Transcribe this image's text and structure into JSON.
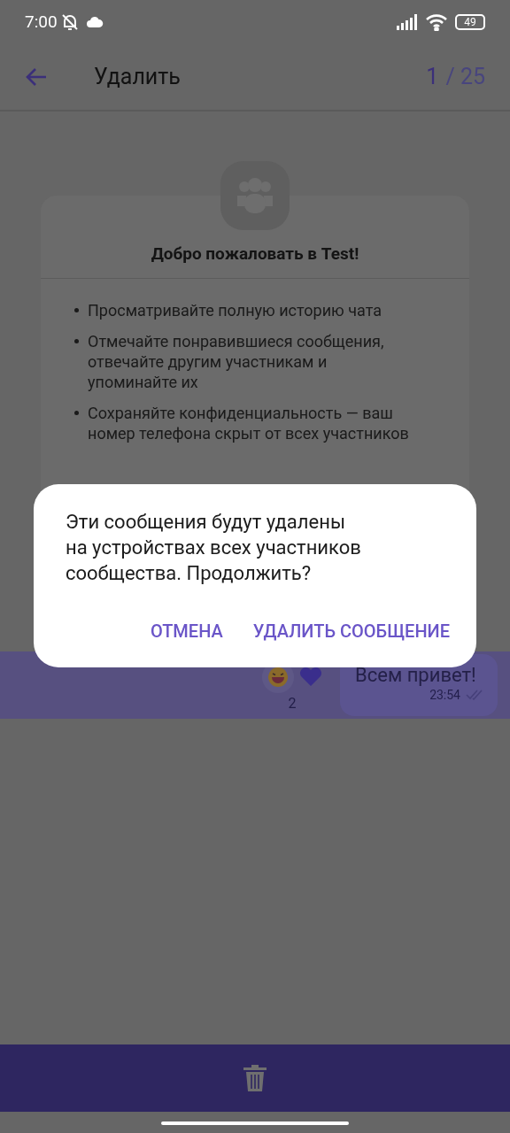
{
  "status_bar": {
    "time": "7:00",
    "battery": "49"
  },
  "header": {
    "title": "Удалить",
    "current": "1",
    "total": "/ 25"
  },
  "welcome": {
    "title": "Добро пожаловать в Test!",
    "bullets": [
      "Просматривайте полную историю чата",
      "Отмечайте понравившиеся сообщения, отвечайте другим участникам и упоминайте их",
      "Сохраняйте конфиденциальность — ваш номер телефона скрыт от всех участников"
    ]
  },
  "message": {
    "text": "Всем привет!",
    "time": "23:54",
    "reaction_count": "2",
    "selected": true
  },
  "dialog": {
    "message": "Эти сообщения будут удалены на устройствах всех участников сообщества. Продолжить?",
    "buttons": [
      "ОТМЕНА",
      "УДАЛИТЬ СООБЩЕНИЕ"
    ]
  }
}
